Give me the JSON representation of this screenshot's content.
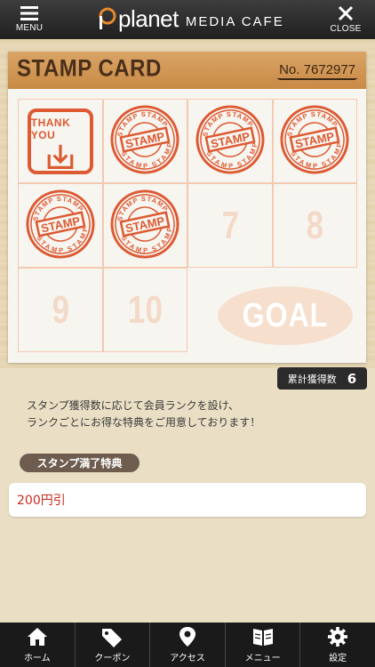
{
  "header": {
    "menu_label": "MENU",
    "close_label": "CLOSE",
    "brand": "planet",
    "brand_sub": "MEDIA CAFE"
  },
  "card": {
    "title": "STAMP CARD",
    "number": "No. 7672977",
    "thank_you": "THANK YOU",
    "stamp_word": "STAMP",
    "stamped_count": 6,
    "slots": [
      "7",
      "8",
      "9",
      "10"
    ],
    "goal": "GOAL"
  },
  "count": {
    "label": "累計獲得数",
    "value": "6"
  },
  "description": {
    "line1": "スタンプ獲得数に応じて会員ランクを設け、",
    "line2": "ランクごとにお得な特典をご用意しております！"
  },
  "benefit": {
    "heading": "スタンプ満了特典",
    "item": "200円引"
  },
  "nav": {
    "items": [
      {
        "label": "ホーム",
        "icon": "home-icon"
      },
      {
        "label": "クーポン",
        "icon": "coupon-tag-icon"
      },
      {
        "label": "アクセス",
        "icon": "map-pin-icon"
      },
      {
        "label": "メニュー",
        "icon": "book-icon"
      },
      {
        "label": "設定",
        "icon": "gear-icon"
      }
    ]
  },
  "colors": {
    "stamp": "#dd5a33",
    "header": "#2a2a2a",
    "benefit_text": "#cc2a1e"
  }
}
